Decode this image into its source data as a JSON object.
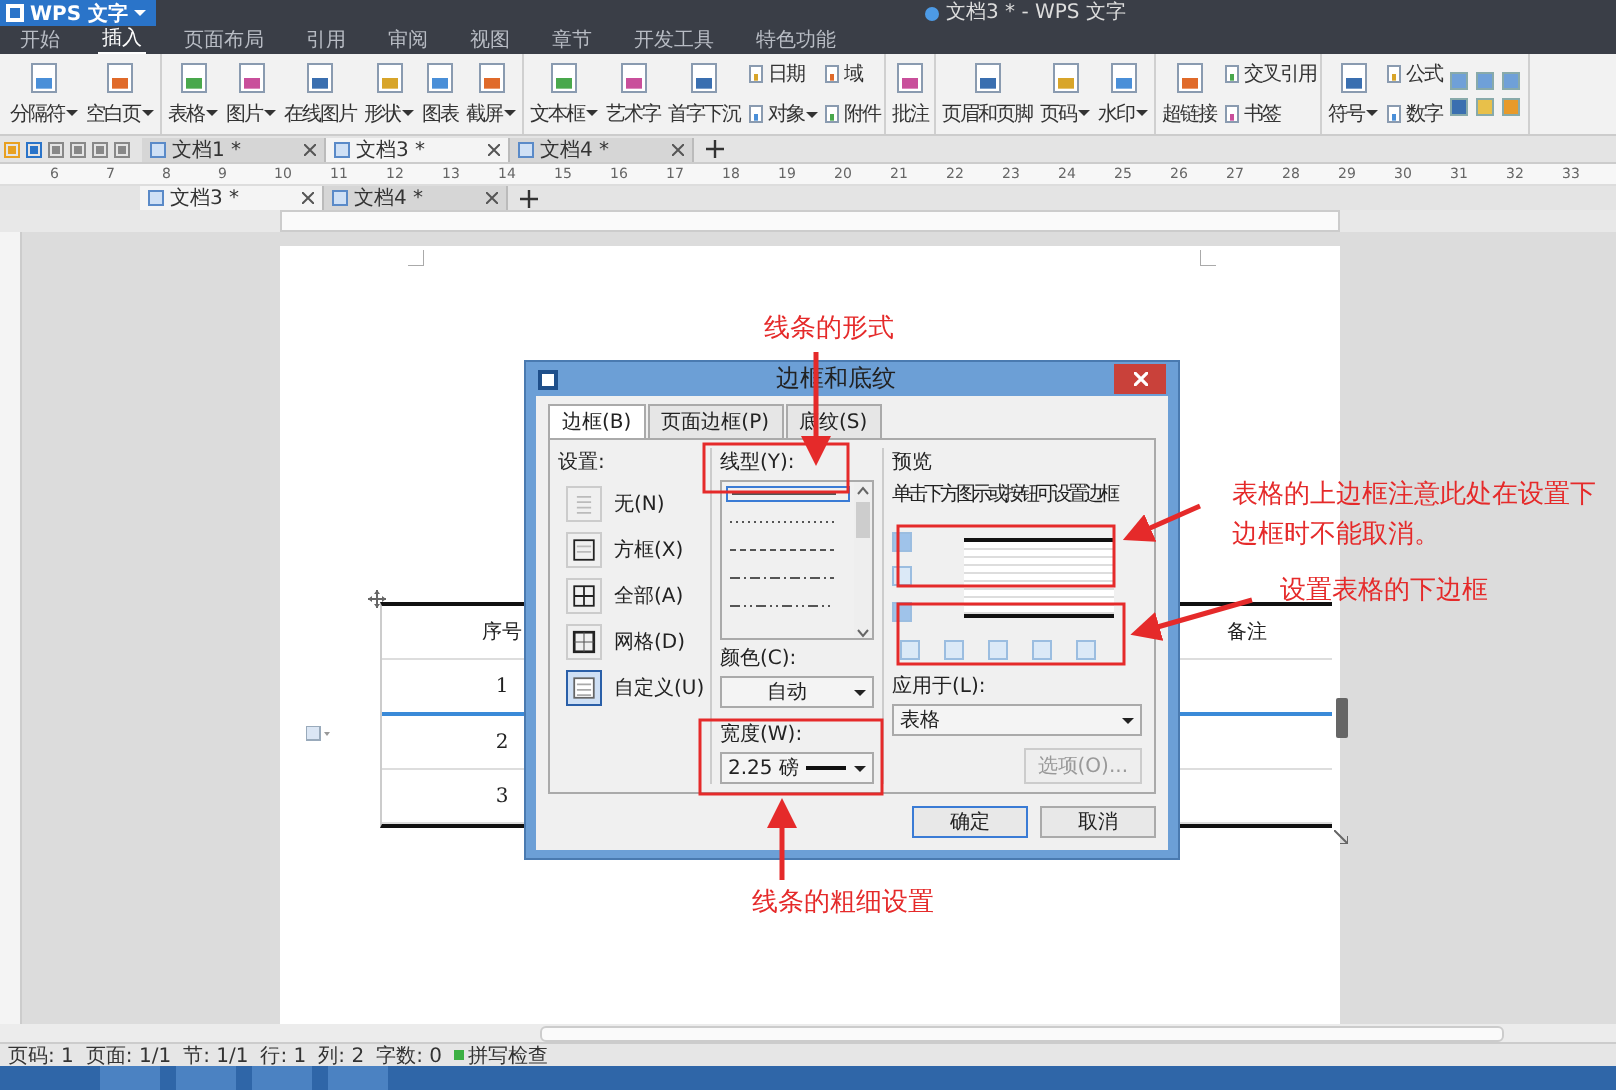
{
  "app": {
    "logo": "WPS 文字",
    "title": "文档3 * - WPS 文字"
  },
  "menu_tabs": [
    {
      "label": "开始",
      "selected": false
    },
    {
      "label": "插入",
      "selected": true
    },
    {
      "label": "页面布局",
      "selected": false
    },
    {
      "label": "引用",
      "selected": false
    },
    {
      "label": "审阅",
      "selected": false
    },
    {
      "label": "视图",
      "selected": false
    },
    {
      "label": "章节",
      "selected": false
    },
    {
      "label": "开发工具",
      "selected": false
    },
    {
      "label": "特色功能",
      "selected": false
    }
  ],
  "ribbon": [
    {
      "items": [
        {
          "kind": "large",
          "label": "分隔符",
          "dropdown": true
        },
        {
          "kind": "large",
          "label": "空白页",
          "dropdown": true
        }
      ]
    },
    {
      "items": [
        {
          "kind": "large",
          "label": "表格",
          "dropdown": true
        },
        {
          "kind": "large",
          "label": "图片",
          "dropdown": true
        },
        {
          "kind": "large",
          "label": "在线图片",
          "dropdown": false
        },
        {
          "kind": "large",
          "label": "形状",
          "dropdown": true
        },
        {
          "kind": "large",
          "label": "图表",
          "dropdown": false
        },
        {
          "kind": "large",
          "label": "截屏",
          "dropdown": true
        }
      ]
    },
    {
      "items": [
        {
          "kind": "large",
          "label": "文本框",
          "dropdown": true
        },
        {
          "kind": "large",
          "label": "艺术字",
          "dropdown": false
        },
        {
          "kind": "large",
          "label": "首字下沉",
          "dropdown": false
        },
        {
          "kind": "stack",
          "items": [
            {
              "label": "日期",
              "dropdown": false
            },
            {
              "label": "对象",
              "dropdown": true
            }
          ]
        },
        {
          "kind": "stack",
          "items": [
            {
              "label": "域",
              "dropdown": false
            },
            {
              "label": "附件",
              "dropdown": false
            }
          ]
        }
      ]
    },
    {
      "items": [
        {
          "kind": "large",
          "label": "批注",
          "dropdown": false
        }
      ]
    },
    {
      "items": [
        {
          "kind": "large",
          "label": "页眉和页脚",
          "dropdown": false
        },
        {
          "kind": "large",
          "label": "页码",
          "dropdown": true
        },
        {
          "kind": "large",
          "label": "水印",
          "dropdown": true
        }
      ]
    },
    {
      "items": [
        {
          "kind": "large",
          "label": "超链接",
          "dropdown": false
        },
        {
          "kind": "stack",
          "items": [
            {
              "label": "交叉引用",
              "dropdown": false
            },
            {
              "label": "书签",
              "dropdown": false
            }
          ]
        }
      ]
    },
    {
      "items": [
        {
          "kind": "large",
          "label": "符号",
          "dropdown": true
        },
        {
          "kind": "stack",
          "items": [
            {
              "label": "公式",
              "dropdown": false
            },
            {
              "label": "数字",
              "dropdown": false
            }
          ]
        },
        {
          "kind": "icons"
        }
      ]
    }
  ],
  "doc_tabs": [
    {
      "label": "文档1 *",
      "selected": false
    },
    {
      "label": "文档3 *",
      "selected": true
    },
    {
      "label": "文档4 *",
      "selected": false
    }
  ],
  "doc_tabs_2": [
    {
      "label": "文档3 *",
      "selected": true
    },
    {
      "label": "文档4 *",
      "selected": false
    }
  ],
  "ruler": [
    "6",
    "7",
    "8",
    "9",
    "10",
    "11",
    "12",
    "13",
    "14",
    "15",
    "16",
    "17",
    "18",
    "19",
    "20",
    "21",
    "22",
    "23",
    "24",
    "25",
    "26",
    "27",
    "28",
    "29",
    "30",
    "31",
    "32",
    "33"
  ],
  "table": {
    "columns": [
      "序号",
      "备注"
    ],
    "rows": [
      "1",
      "2",
      "3"
    ]
  },
  "dialog": {
    "title": "边框和底纹",
    "tabs": [
      {
        "label": "边框(B)",
        "selected": true
      },
      {
        "label": "页面边框(P)",
        "selected": false
      },
      {
        "label": "底纹(S)",
        "selected": false
      }
    ],
    "settings_label": "设置:",
    "settings": [
      {
        "label": "无(N)",
        "kind": "none",
        "selected": false
      },
      {
        "label": "方框(X)",
        "kind": "box",
        "selected": false
      },
      {
        "label": "全部(A)",
        "kind": "all",
        "selected": false
      },
      {
        "label": "网格(D)",
        "kind": "grid",
        "selected": false
      },
      {
        "label": "自定义(U)",
        "kind": "custom",
        "selected": true
      }
    ],
    "line_style_label": "线型(Y):",
    "line_styles": [
      {
        "kind": "solid",
        "selected": true
      },
      {
        "kind": "dotted",
        "selected": false
      },
      {
        "kind": "dashed",
        "selected": false
      },
      {
        "kind": "dashdot",
        "selected": false
      },
      {
        "kind": "dashdotdot",
        "selected": false
      }
    ],
    "color_label": "颜色(C):",
    "color_value": "自动",
    "width_label": "宽度(W):",
    "width_value": "2.25 磅",
    "preview_label": "预览",
    "preview_hint": "单击下方图示或按钮可设置边框",
    "top_border": true,
    "bottom_border": true,
    "apply_label": "应用于(L):",
    "apply_value": "表格",
    "options_button": {
      "label": "选项(O)...",
      "disabled": true
    },
    "buttons": [
      "确定",
      "取消"
    ]
  },
  "annotations": [
    {
      "text": "线条的形式"
    },
    {
      "text": "表格的上边框注意此处在设置下边框时不能取消。"
    },
    {
      "text": "设置表格的下边框"
    },
    {
      "text": "线条的粗细设置"
    }
  ],
  "status_bar": [
    "页码: 1",
    "页面: 1/1",
    "节: 1/1",
    "行: 1",
    "列: 2",
    "字数: 0"
  ],
  "spell_check": "拼写检查"
}
